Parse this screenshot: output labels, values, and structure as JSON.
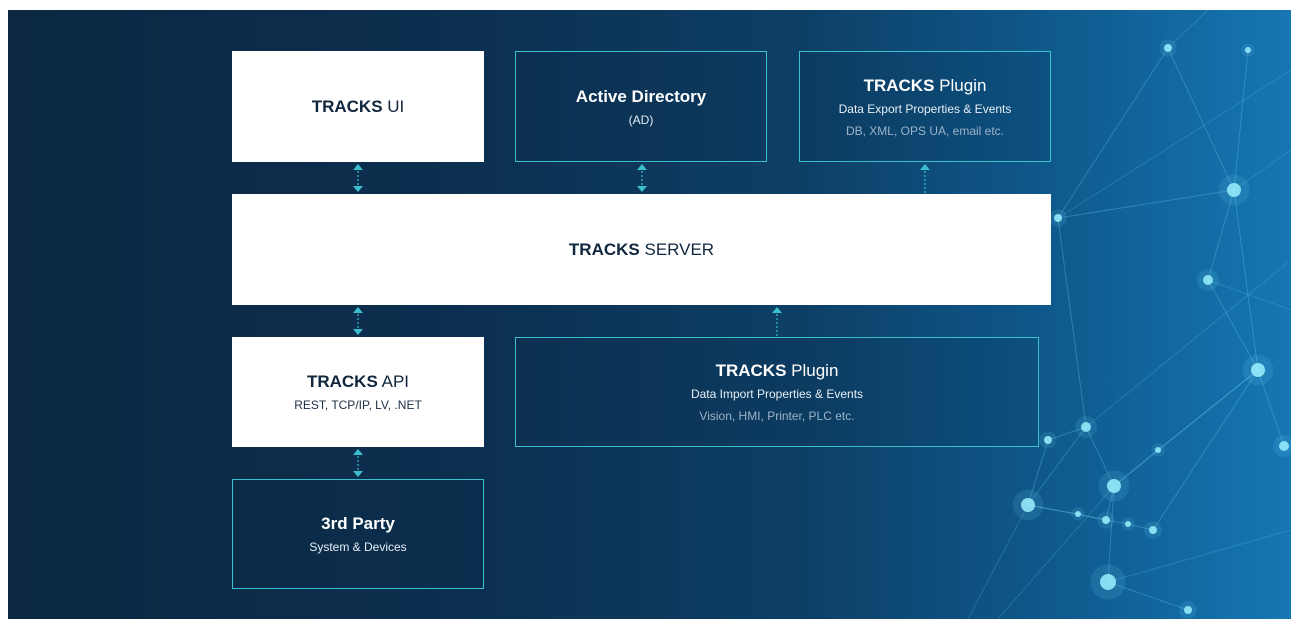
{
  "colors": {
    "accent": "#39bfcd",
    "box_fill": "#ffffff",
    "box_text": "#10263d",
    "muted_text": "#9cb3c9"
  },
  "boxes": {
    "tracks_ui": {
      "title_bold": "TRACKS",
      "title_normal": "UI"
    },
    "active_directory": {
      "title_bold": "Active Directory",
      "subtitle": "(AD)"
    },
    "plugin_export": {
      "title_bold": "TRACKS",
      "title_normal": "Plugin",
      "subtitle": "Data Export Properties & Events",
      "detail": "DB, XML, OPS UA, email etc."
    },
    "server": {
      "title_bold": "TRACKS",
      "title_normal": "SERVER"
    },
    "api": {
      "title_bold": "TRACKS",
      "title_normal": "API",
      "subtitle": "REST, TCP/IP, LV, .NET"
    },
    "plugin_import": {
      "title_bold": "TRACKS",
      "title_normal": "Plugin",
      "subtitle": "Data Import Properties & Events",
      "detail": "Vision, HMI, Printer, PLC etc."
    },
    "third_party": {
      "title_bold": "3rd Party",
      "subtitle": "System & Devices"
    }
  },
  "connectors": [
    {
      "from": "TRACKS UI",
      "to": "TRACKS SERVER",
      "direction": "bidirectional"
    },
    {
      "from": "Active Directory",
      "to": "TRACKS SERVER",
      "direction": "bidirectional"
    },
    {
      "from": "TRACKS SERVER",
      "to": "TRACKS Plugin (Export)",
      "direction": "up"
    },
    {
      "from": "TRACKS SERVER",
      "to": "TRACKS API",
      "direction": "bidirectional"
    },
    {
      "from": "TRACKS Plugin (Import)",
      "to": "TRACKS SERVER",
      "direction": "up"
    },
    {
      "from": "TRACKS API",
      "to": "3rd Party",
      "direction": "bidirectional"
    }
  ]
}
